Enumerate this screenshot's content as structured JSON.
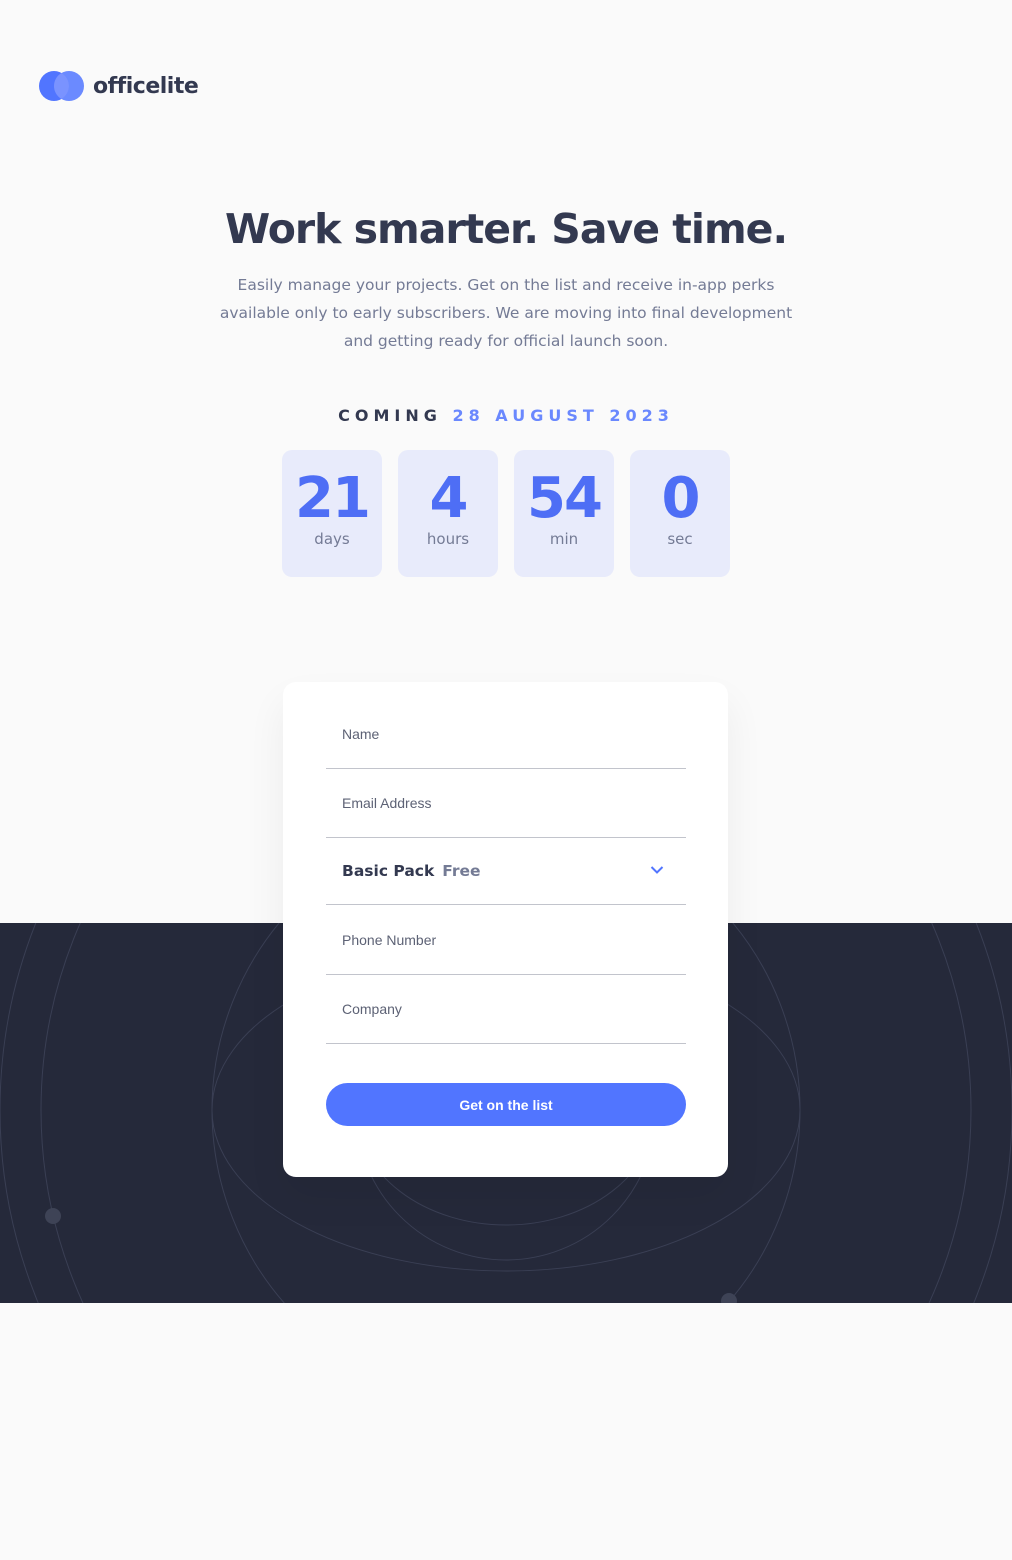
{
  "brand": {
    "name": "officelite"
  },
  "hero": {
    "title": "Work smarter. Save time.",
    "description": "Easily manage your projects. Get on the list and receive in-app perks available only to early subscribers. We are moving into final development and getting ready for official launch soon."
  },
  "launch": {
    "label": "COMING",
    "date": "28 AUGUST 2023"
  },
  "countdown": [
    {
      "value": "21",
      "unit": "days"
    },
    {
      "value": "4",
      "unit": "hours"
    },
    {
      "value": "54",
      "unit": "min"
    },
    {
      "value": "0",
      "unit": "sec"
    }
  ],
  "form": {
    "name_placeholder": "Name",
    "email_placeholder": "Email Address",
    "plan": {
      "name": "Basic Pack",
      "price": "Free"
    },
    "phone_placeholder": "Phone Number",
    "company_placeholder": "Company",
    "submit_label": "Get on the list"
  },
  "colors": {
    "accent": "#5175ff",
    "dark_band": "#25293a",
    "heading": "#333950",
    "body_text": "#747b95",
    "countdown_bg": "#e8ebfb"
  }
}
